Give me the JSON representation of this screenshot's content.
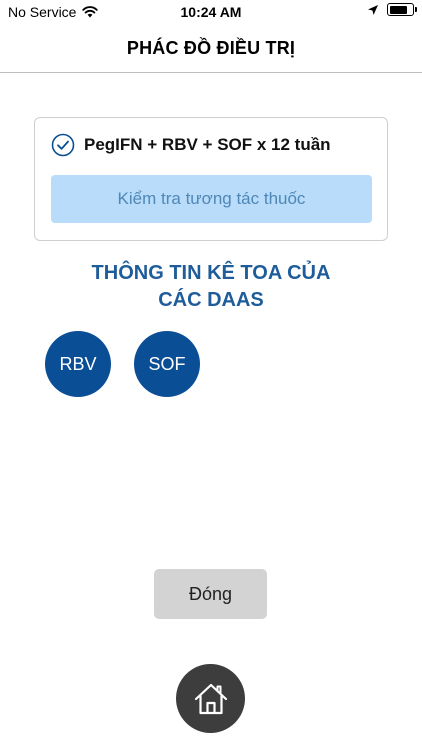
{
  "status_bar": {
    "carrier": "No Service",
    "time": "10:24 AM",
    "battery_level": 0.8,
    "icons": [
      "wifi-icon",
      "location-arrow-icon",
      "battery-icon"
    ]
  },
  "nav": {
    "title": "PHÁC ĐỒ ĐIỀU TRỊ"
  },
  "regimen": {
    "label": "PegIFN + RBV + SOF x 12 tuần",
    "selected": true,
    "check_interaction_button": "Kiểm tra tương tác thuốc"
  },
  "section": {
    "line1": "THÔNG TIN KÊ TOA CỦA",
    "line2": "CÁC DAAS"
  },
  "drugs": [
    {
      "label": "RBV"
    },
    {
      "label": "SOF"
    }
  ],
  "actions": {
    "close_label": "Đóng",
    "home_icon": "home-icon"
  },
  "colors": {
    "accent_blue": "#0a4e96",
    "heading_blue": "#1e5d99",
    "button_light_blue": "#b8dcf9",
    "button_text_blue": "#4f87b7",
    "close_gray": "#d3d3d3",
    "home_dark": "#3d3d3d"
  }
}
